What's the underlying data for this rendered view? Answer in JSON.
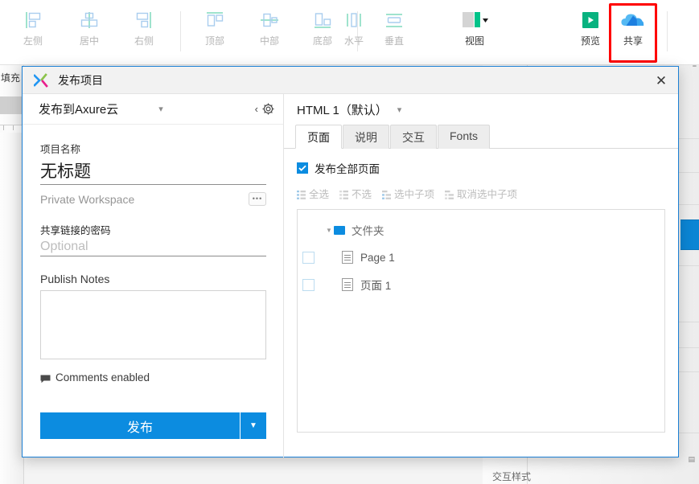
{
  "toolbar": {
    "items": [
      {
        "label": "左侧",
        "icon": "align-left-icon"
      },
      {
        "label": "居中",
        "icon": "align-center-h-icon"
      },
      {
        "label": "右侧",
        "icon": "align-right-icon"
      },
      {
        "label": "顶部",
        "icon": "align-top-icon"
      },
      {
        "label": "中部",
        "icon": "align-middle-icon"
      },
      {
        "label": "底部",
        "icon": "align-bottom-icon"
      },
      {
        "label": "水平",
        "icon": "distribute-horizontal-icon"
      },
      {
        "label": "垂直",
        "icon": "distribute-vertical-icon"
      },
      {
        "label": "视图",
        "icon": "view-icon"
      },
      {
        "label": "预览",
        "icon": "preview-play-icon"
      },
      {
        "label": "共享",
        "icon": "share-cloud-icon"
      }
    ],
    "accent_green": "#00c389",
    "accent_blue": "#1f8ff0",
    "highlight_color": "#ff0000"
  },
  "background": {
    "left_label": "填充",
    "bottom_label": "交互样式"
  },
  "dialog": {
    "title": "发布项目",
    "logo_icon": "axure-logo-icon",
    "close_icon": "close-icon",
    "left": {
      "destination": "发布到Axure云",
      "destination_caret_icon": "chevron-down-icon",
      "back_icon": "chevron-left-icon",
      "settings_icon": "gear-icon",
      "project_name_label": "项目名称",
      "project_name_value": "无标题",
      "workspace_value": "Private Workspace",
      "workspace_more_icon": "ellipsis-icon",
      "password_label": "共享链接的密码",
      "password_value": "",
      "password_placeholder": "Optional",
      "publish_notes_label": "Publish Notes",
      "publish_notes_value": "",
      "comments_icon": "comment-icon",
      "comments_label": "Comments enabled",
      "publish_button": "发布",
      "publish_dropdown_icon": "caret-down-icon"
    },
    "right": {
      "config_name": "HTML 1（默认）",
      "config_caret_icon": "chevron-down-icon",
      "tabs": [
        {
          "label": "页面",
          "active": true
        },
        {
          "label": "说明",
          "active": false
        },
        {
          "label": "交互",
          "active": false
        },
        {
          "label": "Fonts",
          "active": false
        }
      ],
      "publish_all_label": "发布全部页面",
      "publish_all_checked": true,
      "check_icon": "checkmark-icon",
      "select_tools": [
        {
          "label": "全选",
          "icon": "select-all-icon"
        },
        {
          "label": "不选",
          "icon": "select-none-icon"
        },
        {
          "label": "选中子项",
          "icon": "select-children-icon"
        },
        {
          "label": "取消选中子项",
          "icon": "deselect-children-icon"
        }
      ],
      "tree": [
        {
          "label": "文件夹",
          "type": "folder",
          "icon": "folder-icon",
          "expanded": true,
          "level": 0,
          "checkbox": false
        },
        {
          "label": "Page 1",
          "type": "page",
          "icon": "page-icon",
          "level": 1,
          "checkbox": true,
          "checked": false
        },
        {
          "label": "页面 1",
          "type": "page",
          "icon": "page-icon",
          "level": 1,
          "checkbox": true,
          "checked": false
        }
      ]
    }
  }
}
